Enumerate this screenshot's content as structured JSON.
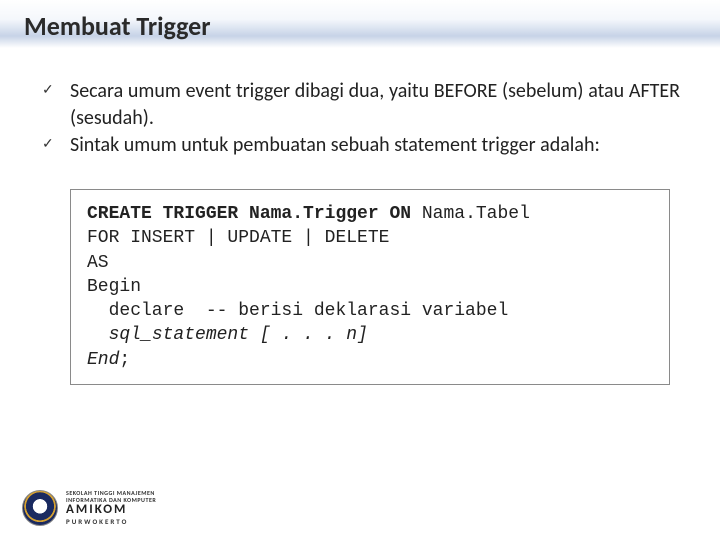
{
  "title": "Membuat Trigger",
  "bullets": [
    "Secara umum event trigger dibagi dua, yaitu BEFORE (sebelum) atau AFTER (sesudah).",
    "Sintak umum untuk pembuatan sebuah statement trigger adalah:"
  ],
  "code": {
    "l1a": "CREATE TRIGGER Nama.Trigger ON ",
    "l1b": "Nama.Tabel",
    "l2": "FOR INSERT | UPDATE | DELETE",
    "l3": "AS",
    "l4": "Begin",
    "l5": "  declare  -- berisi deklarasi variabel",
    "l6a": "  ",
    "l6b": "sql_statement [ . . . n]",
    "l7a": "End",
    "l7b": ";"
  },
  "footer": {
    "line1a": "SEKOLAH TINGGI MANAJEMEN",
    "line1b": "INFORMATIKA DAN KOMPUTER",
    "line2": "AMIKOM",
    "line3": "PURWOKERTO"
  }
}
